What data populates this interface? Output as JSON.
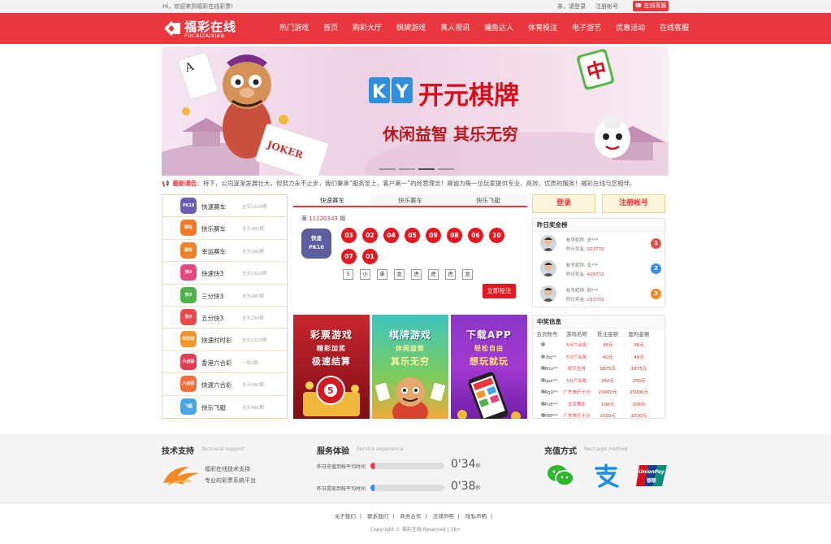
{
  "topbar": {
    "welcome": "Hi，欢迎来到福彩在线彩票!",
    "login": "亲，请登录",
    "register": "注册帐号",
    "service": "在线客服"
  },
  "logo": {
    "name": "福彩在线",
    "pinyin": "FUCAIZAIXIAN"
  },
  "nav": [
    "热门游戏",
    "首页",
    "购彩大厅",
    "棋牌游戏",
    "真人视讯",
    "捕鱼达人",
    "体育投注",
    "电子游艺",
    "优惠活动",
    "在线客服"
  ],
  "banner": {
    "brand": "KY",
    "title": "开元棋牌",
    "slogan": "休闲益智 其乐无穷",
    "card": "JOKER"
  },
  "notice": {
    "label": "最新通告",
    "text": "：持下，公司逐渐发展壮大，但努力永不止步，我们秉承“服务至上，客户第一”的经营理念！竭诚为每一位玩家提供专业、高效、优质的服务！福彩在线与您相伴。"
  },
  "games": [
    {
      "name": "快速赛车",
      "sub": "全天1329期",
      "icon": "PK10",
      "color": "#6b5bb3"
    },
    {
      "name": "快乐赛车",
      "sub": "全天480期",
      "icon": "赛车",
      "color": "#f07a2a"
    },
    {
      "name": "幸运赛车",
      "sub": "全天288期",
      "icon": "赛车",
      "color": "#f0832a"
    },
    {
      "name": "快速快3",
      "sub": "全天1329期",
      "icon": "快3",
      "color": "#e3477c"
    },
    {
      "name": "三分快3",
      "sub": "全天480期",
      "icon": "快3",
      "color": "#4fb449"
    },
    {
      "name": "五分快3",
      "sub": "全天288期",
      "icon": "快3",
      "color": "#e74a4a"
    },
    {
      "name": "快速时时彩",
      "sub": "全天1329期",
      "icon": "时时彩",
      "color": "#f3962a"
    },
    {
      "name": "香港六合彩",
      "sub": "一周3期",
      "icon": "六合彩",
      "color": "#e33d55"
    },
    {
      "name": "快速六合彩",
      "sub": "全天960期",
      "icon": "六合彩",
      "color": "#f06f3a"
    },
    {
      "name": "快乐飞艇",
      "sub": "全天480期",
      "icon": "飞艇",
      "color": "#4aa7e3"
    }
  ],
  "lottery": {
    "tabs": [
      "快速赛车",
      "快乐赛车",
      "快乐飞艇"
    ],
    "issue_prefix": "第",
    "issue": "11120343",
    "issue_suffix": "期",
    "icon_text": "快速",
    "icon_sub": "PK10",
    "balls": [
      "03",
      "02",
      "04",
      "05",
      "09",
      "08",
      "06",
      "10",
      "07",
      "01"
    ],
    "tags": [
      "5",
      "小",
      "单",
      "龙",
      "虎",
      "虎",
      "虎",
      "龙"
    ],
    "bet_button": "立即投注"
  },
  "promos": [
    {
      "title": "彩票游戏",
      "line2": "精彩加奖",
      "line3": "极速结算"
    },
    {
      "title": "棋牌游戏",
      "line2": "休闲益智",
      "line3": "其乐无穷"
    },
    {
      "title": "下载APP",
      "line2": "轻松自由",
      "line3": "想玩就玩"
    }
  ],
  "auth": {
    "login": "登录",
    "register": "注册帐号"
  },
  "ranking": {
    "title": "昨日奖金榜",
    "nick_label": "帐号昵称:",
    "prize_label": "昨日奖金:",
    "rows": [
      {
        "nick": "进***",
        "prize": "923770",
        "rank": "1",
        "color": "#d9534f"
      },
      {
        "nick": "龙***",
        "prize": "420732",
        "rank": "2",
        "color": "#3a8ee6"
      },
      {
        "nick": "网***",
        "prize": "231702",
        "rank": "3",
        "color": "#f08a24"
      }
    ]
  },
  "winners": {
    "title": "中奖信息",
    "headers": [
      "会员账号",
      "游戏名称",
      "投注金额",
      "盈利金额"
    ],
    "rows": [
      [
        "8g**",
        "5分六合彩",
        "36元",
        "36元"
      ],
      [
        "80u**",
        "5分六合彩",
        "40元",
        "40元"
      ],
      [
        "qae**",
        "欢乐生肖",
        "1875元",
        "1875元"
      ],
      [
        "8g9**",
        "5分六合彩",
        "250元",
        "250元"
      ],
      [
        "PUE**",
        "广东快乐十分",
        "25000元",
        "25000元"
      ],
      [
        "HBP**",
        "北京赛车",
        "108元",
        "108元"
      ],
      [
        "ntt**",
        "广东快乐十分",
        "1530元",
        "1530元"
      ]
    ]
  },
  "footer": {
    "tech_title": "技术支持",
    "tech_sub": "Technical support",
    "tech_line1": "福彩在线技术支持",
    "tech_line2": "专业的彩票系统平台",
    "svc_title": "服务体验",
    "svc_sub": "Service experience",
    "deposit_label": "昨日充值到帐平均时间",
    "deposit_time": "0'34",
    "deposit_progress": 0.06,
    "withdraw_label": "昨日提现到帐平均时间",
    "withdraw_time": "0'38",
    "withdraw_progress": 0.06,
    "unit": "秒",
    "pay_title": "充值方式",
    "pay_sub": "Recharge method",
    "unionpay": "UnionPay",
    "unionpay_cn": "银联"
  },
  "bottom": {
    "links": [
      "关于我们",
      "联系我们",
      "商务合作",
      "法律声明",
      "隐私声明"
    ],
    "copyright": "Copyright © 福彩在线 Reserved | 18+"
  },
  "colors": {
    "brand": "#e8383d",
    "ball": "#e21920",
    "gold_border": "#ecd69c"
  }
}
